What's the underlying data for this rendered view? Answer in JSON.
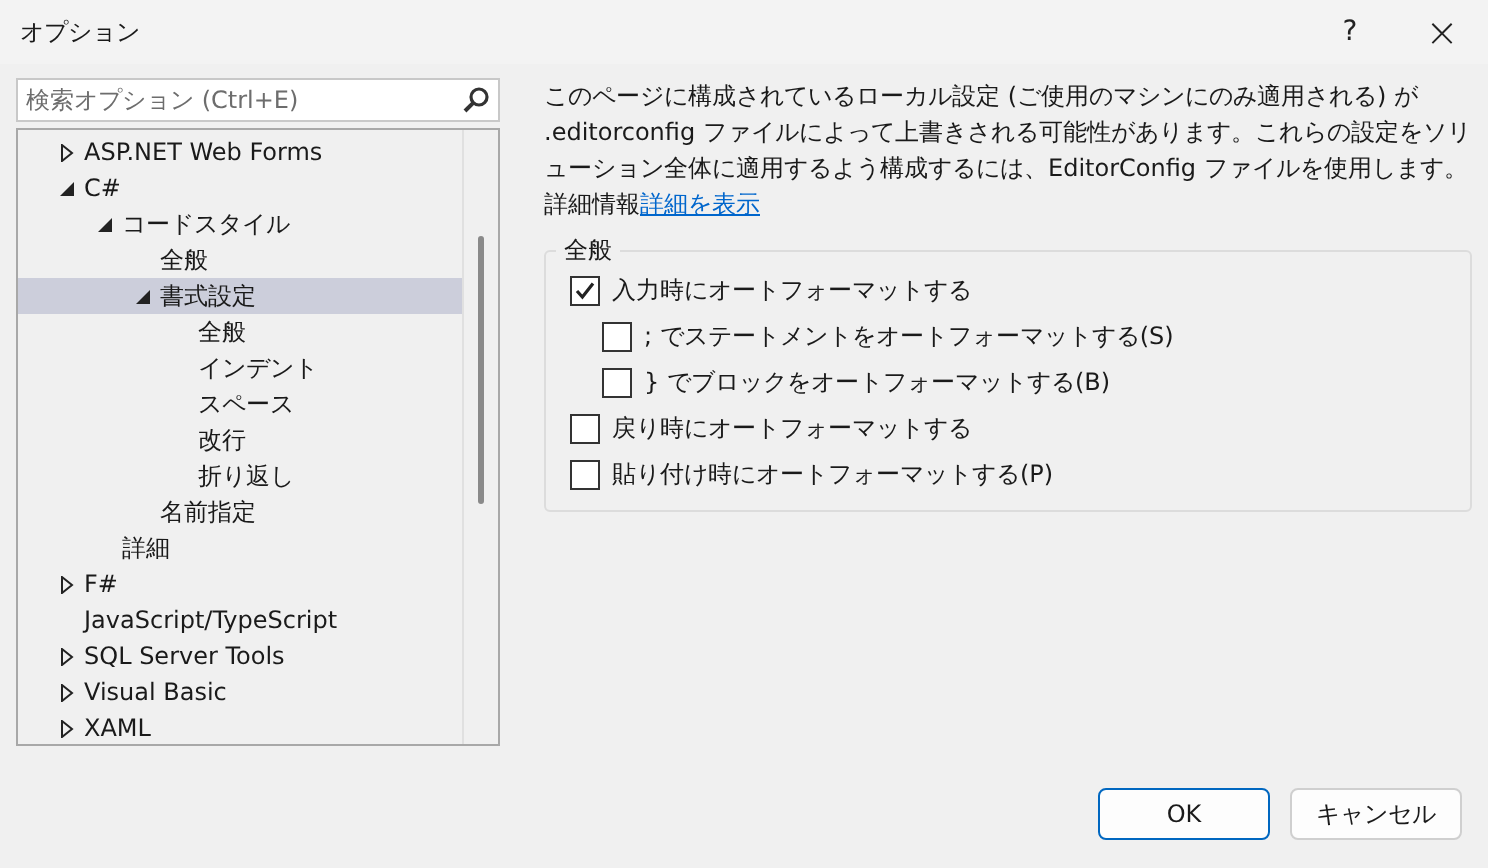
{
  "window": {
    "title": "オプション",
    "help": "?",
    "close": "×"
  },
  "search": {
    "placeholder": "検索オプション (Ctrl+E)"
  },
  "tree": [
    {
      "label": "ASP.NET Web Forms",
      "kind": "branch",
      "expanded": false,
      "selected": false
    },
    {
      "label": "C#",
      "kind": "branch",
      "expanded": true,
      "selected": false,
      "children": [
        {
          "label": "コードスタイル",
          "kind": "branch",
          "expanded": true,
          "selected": false,
          "children": [
            {
              "label": "全般",
              "kind": "leaf",
              "selected": false
            },
            {
              "label": "書式設定",
              "kind": "branch",
              "expanded": true,
              "selected": true,
              "children": [
                {
                  "label": "全般",
                  "kind": "leaf",
                  "selected": false
                },
                {
                  "label": "インデント",
                  "kind": "leaf",
                  "selected": false
                },
                {
                  "label": "スペース",
                  "kind": "leaf",
                  "selected": false
                },
                {
                  "label": "改行",
                  "kind": "leaf",
                  "selected": false
                },
                {
                  "label": "折り返し",
                  "kind": "leaf",
                  "selected": false
                }
              ]
            },
            {
              "label": "名前指定",
              "kind": "leaf",
              "selected": false
            }
          ]
        },
        {
          "label": "詳細",
          "kind": "leaf",
          "selected": false
        }
      ]
    },
    {
      "label": "F#",
      "kind": "branch",
      "expanded": false,
      "selected": false
    },
    {
      "label": "JavaScript/TypeScript",
      "kind": "leaf",
      "selected": false
    },
    {
      "label": "SQL Server Tools",
      "kind": "branch",
      "expanded": false,
      "selected": false
    },
    {
      "label": "Visual Basic",
      "kind": "branch",
      "expanded": false,
      "selected": false
    },
    {
      "label": "XAML",
      "kind": "branch",
      "expanded": false,
      "selected": false
    }
  ],
  "description": {
    "text": "このページに構成されているローカル設定 (ご使用のマシンにのみ適用される) が .editorconfig ファイルによって上書きされる可能性があります。これらの設定をソリューション全体に適用するよう構成するには、EditorConfig ファイルを使用します。詳細情報",
    "link": "詳細を表示"
  },
  "group": {
    "title": "全般",
    "options": [
      {
        "label": "入力時にオートフォーマットする",
        "checked": true,
        "children": [
          {
            "label": "; でステートメントをオートフォーマットする(S)",
            "checked": false
          },
          {
            "label": "} でブロックをオートフォーマットする(B)",
            "checked": false
          }
        ]
      },
      {
        "label": "戻り時にオートフォーマットする",
        "checked": false
      },
      {
        "label": "貼り付け時にオートフォーマットする(P)",
        "checked": false
      }
    ]
  },
  "buttons": [
    {
      "label": "OK",
      "default": true
    },
    {
      "label": "キャンセル",
      "default": false
    }
  ]
}
